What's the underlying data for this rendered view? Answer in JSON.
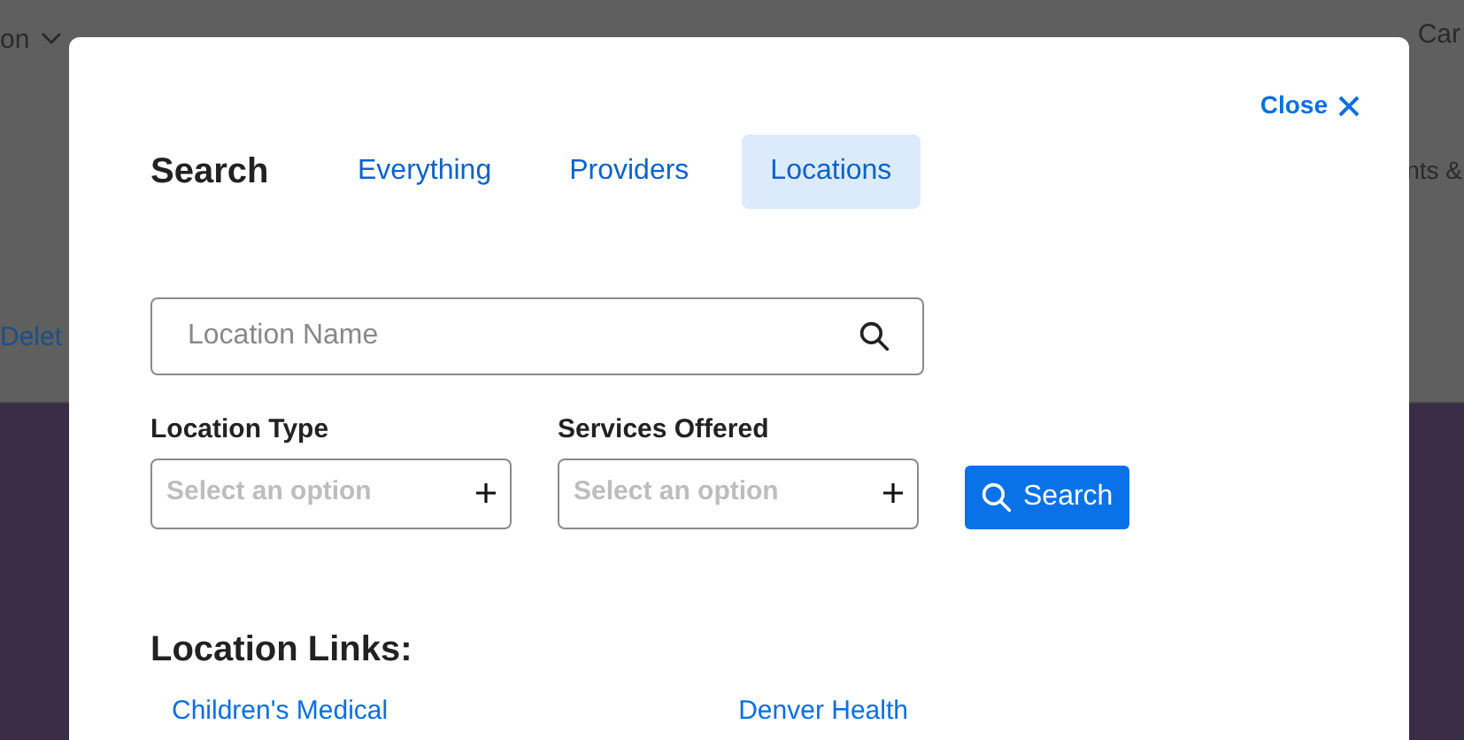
{
  "background": {
    "menu_left": "on",
    "nav_items": [
      "Car"
    ],
    "side_text": "nts &",
    "link_text": "Delet"
  },
  "modal": {
    "close_label": "Close",
    "title": "Search",
    "tabs": [
      {
        "label": "Everything",
        "selected": false
      },
      {
        "label": "Providers",
        "selected": false
      },
      {
        "label": "Locations",
        "selected": true
      }
    ],
    "search_field": {
      "placeholder": "Location Name"
    },
    "filters": [
      {
        "label": "Location Type",
        "placeholder": "Select an option"
      },
      {
        "label": "Services Offered",
        "placeholder": "Select an option"
      }
    ],
    "search_button": "Search",
    "links_heading": "Location Links:",
    "links": [
      "Children's Medical",
      "Denver Health"
    ]
  }
}
